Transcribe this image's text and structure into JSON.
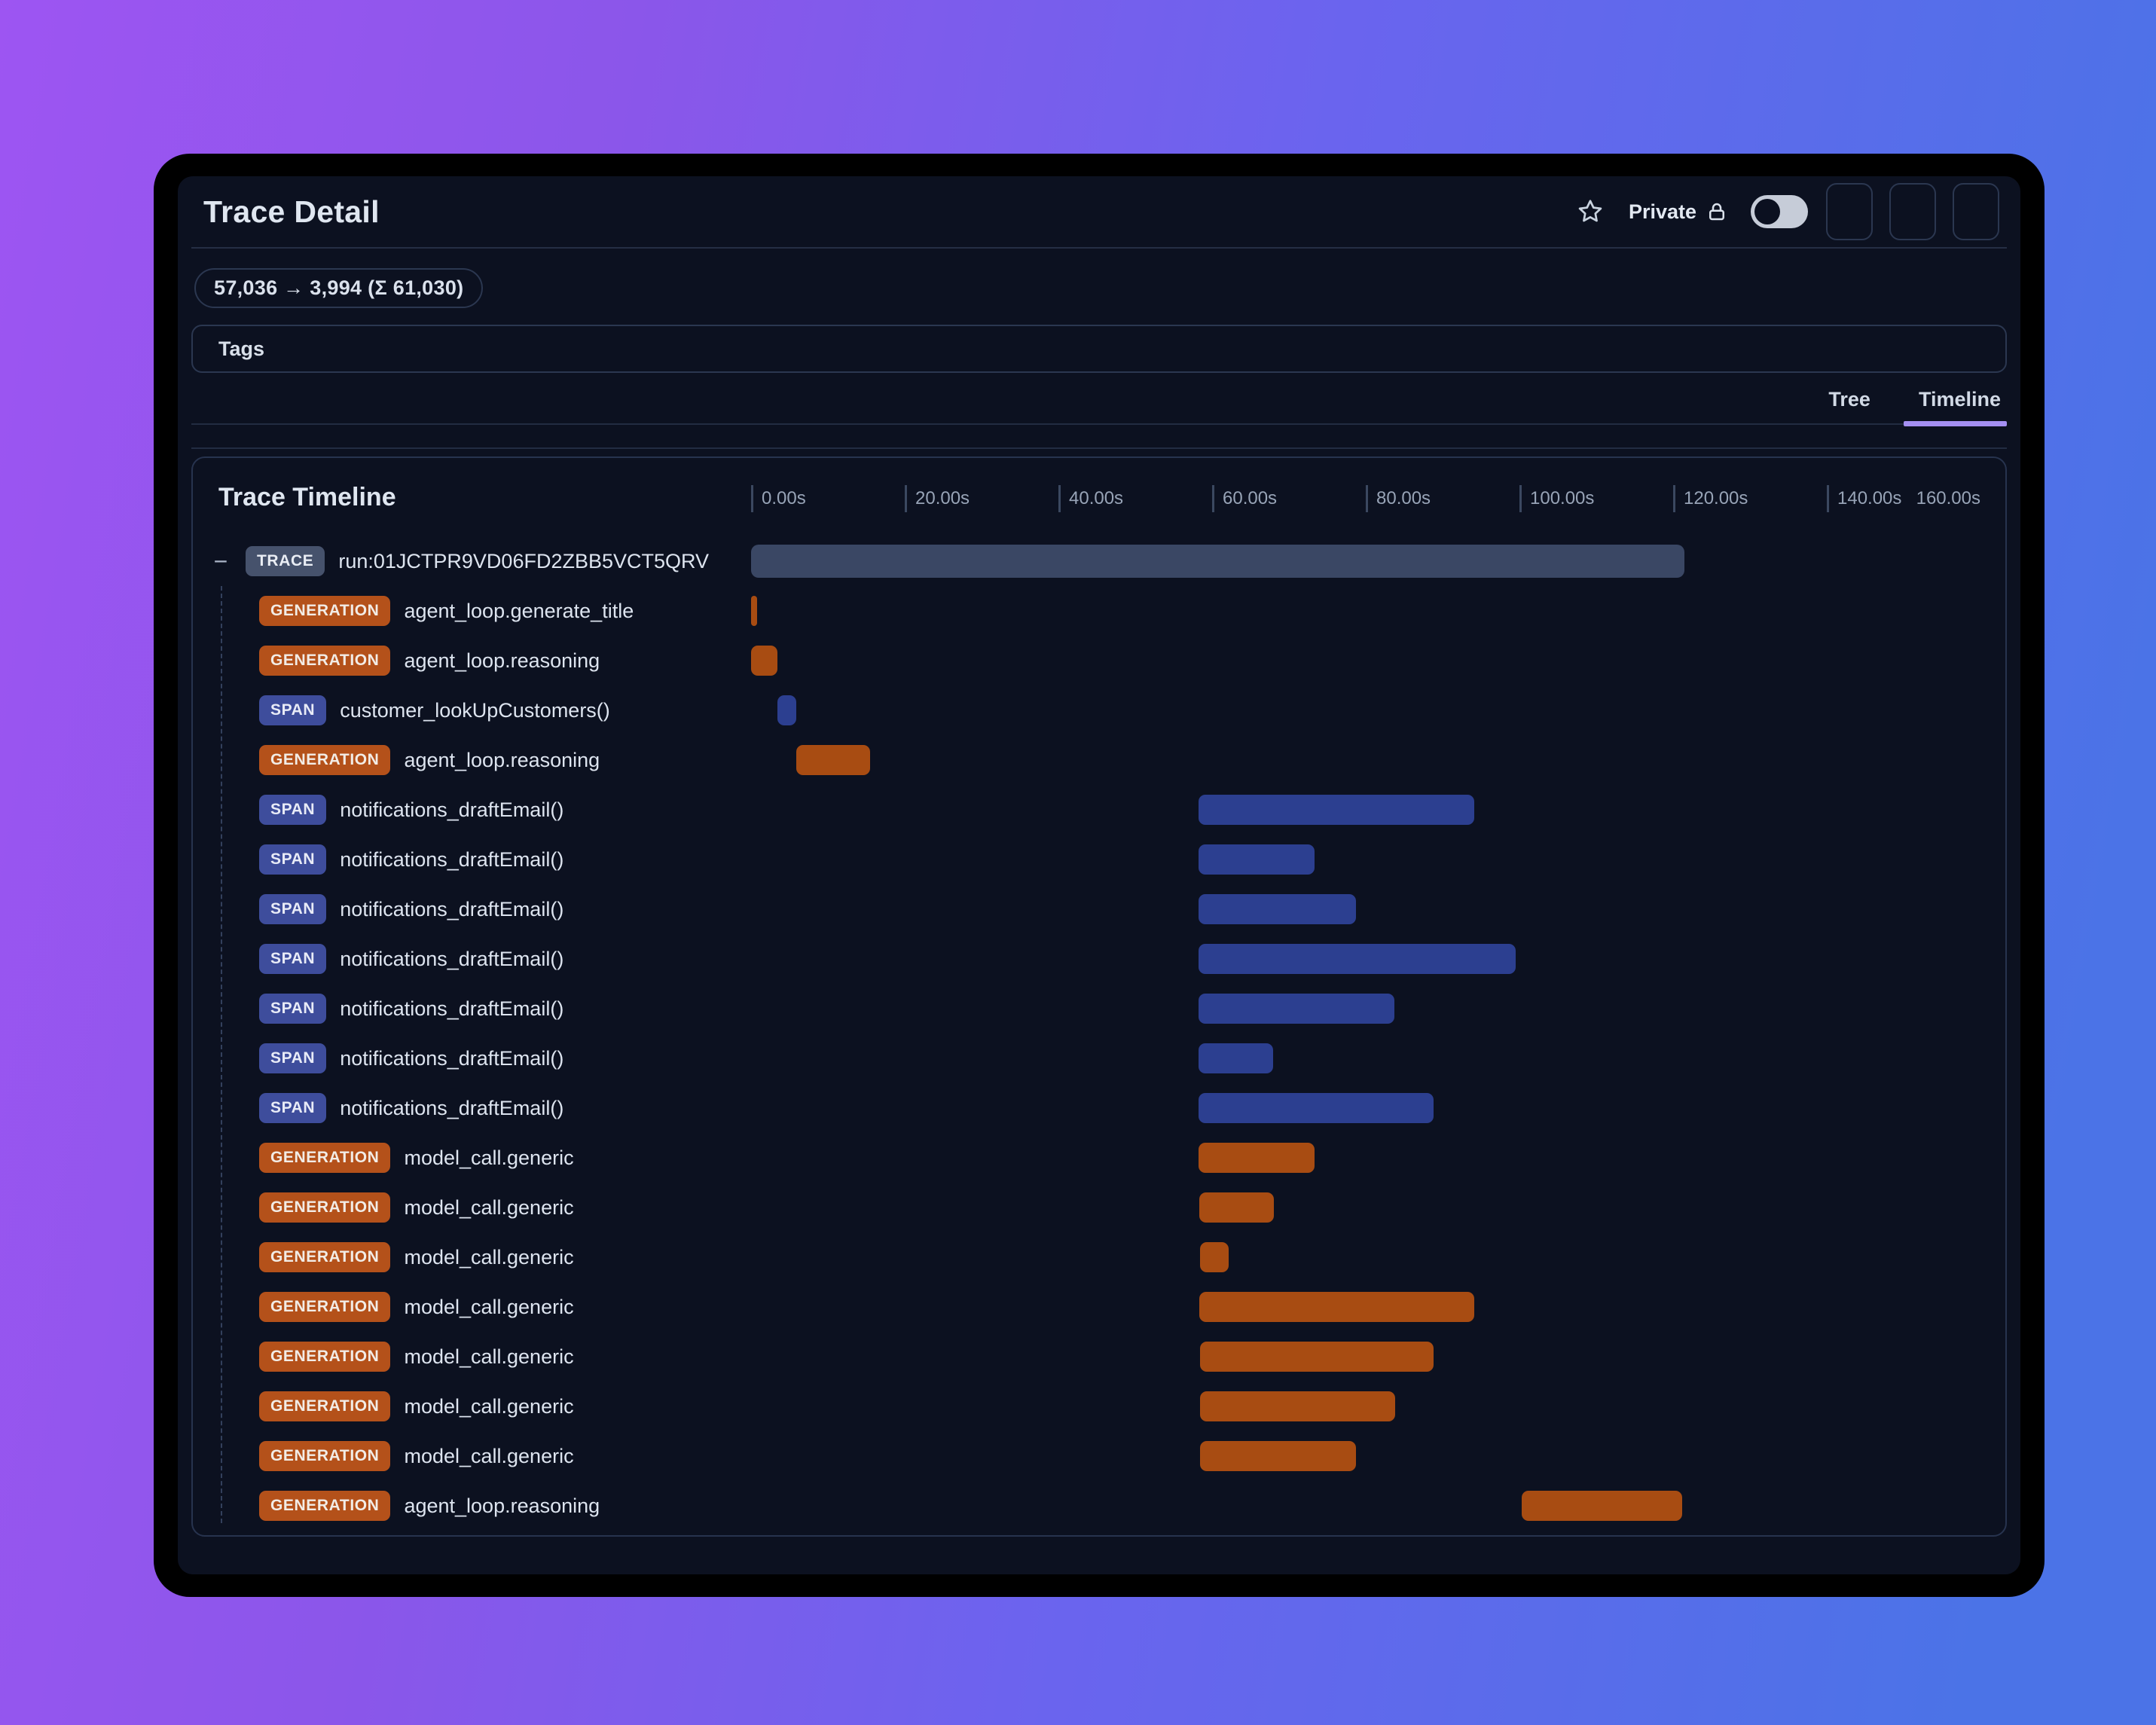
{
  "header": {
    "title": "Trace Detail",
    "favorite_icon": "star-icon",
    "privacy_label": "Private",
    "privacy_icon": "lock-icon",
    "privacy_toggle": {
      "state": "off"
    },
    "buttons": [
      {
        "name": "collapse-up-button",
        "icon": "chevron-up-icon"
      },
      {
        "name": "collapse-down-button",
        "icon": "chevron-down-icon"
      },
      {
        "name": "delete-button",
        "icon": "trash-icon"
      }
    ]
  },
  "token_badge": "57,036 → 3,994 (Σ 61,030)",
  "tags": {
    "label": "Tags"
  },
  "view_tabs": [
    {
      "label": "Tree",
      "icon": "tree-icon",
      "active": false
    },
    {
      "label": "Timeline",
      "icon": "timeline-icon",
      "active": true
    }
  ],
  "timeline": {
    "title": "Trace Timeline",
    "controls": [
      {
        "name": "expand-all-button",
        "icon": "plus-square-icon"
      },
      {
        "name": "collapse-all-button",
        "icon": "minus-square-icon"
      }
    ],
    "collapse_glyph": "−",
    "axis": {
      "max_s": 160,
      "ticks": [
        {
          "s": 0,
          "label": "0.00s"
        },
        {
          "s": 20,
          "label": "20.00s"
        },
        {
          "s": 40,
          "label": "40.00s"
        },
        {
          "s": 60,
          "label": "60.00s"
        },
        {
          "s": 80,
          "label": "80.00s"
        },
        {
          "s": 100,
          "label": "100.00s"
        },
        {
          "s": 120,
          "label": "120.00s"
        },
        {
          "s": 140,
          "label": "140.00s"
        }
      ],
      "end_label": "160.00s"
    },
    "rows": [
      {
        "badge": "TRACE",
        "kind": "trace",
        "name": "run:01JCTPR9VD06FD2ZBB5VCT5QRV",
        "depth": 0,
        "start_s": 0,
        "end_s": 121.5
      },
      {
        "badge": "GENERATION",
        "kind": "generation",
        "name": "agent_loop.generate_title",
        "depth": 1,
        "start_s": 0,
        "end_s": 0.8
      },
      {
        "badge": "GENERATION",
        "kind": "generation",
        "name": "agent_loop.reasoning",
        "depth": 1,
        "start_s": 0,
        "end_s": 3.4
      },
      {
        "badge": "SPAN",
        "kind": "span",
        "name": "customer_lookUpCustomers()",
        "depth": 1,
        "start_s": 3.4,
        "end_s": 5.9
      },
      {
        "badge": "GENERATION",
        "kind": "generation",
        "name": "agent_loop.reasoning",
        "depth": 1,
        "start_s": 5.9,
        "end_s": 15.5
      },
      {
        "badge": "SPAN",
        "kind": "span",
        "name": "notifications_draftEmail()",
        "depth": 1,
        "start_s": 58.2,
        "end_s": 94.1
      },
      {
        "badge": "SPAN",
        "kind": "span",
        "name": "notifications_draftEmail()",
        "depth": 1,
        "start_s": 58.2,
        "end_s": 73.3
      },
      {
        "badge": "SPAN",
        "kind": "span",
        "name": "notifications_draftEmail()",
        "depth": 1,
        "start_s": 58.2,
        "end_s": 78.7
      },
      {
        "badge": "SPAN",
        "kind": "span",
        "name": "notifications_draftEmail()",
        "depth": 1,
        "start_s": 58.2,
        "end_s": 99.5
      },
      {
        "badge": "SPAN",
        "kind": "span",
        "name": "notifications_draftEmail()",
        "depth": 1,
        "start_s": 58.2,
        "end_s": 83.7
      },
      {
        "badge": "SPAN",
        "kind": "span",
        "name": "notifications_draftEmail()",
        "depth": 1,
        "start_s": 58.2,
        "end_s": 67.9
      },
      {
        "badge": "SPAN",
        "kind": "span",
        "name": "notifications_draftEmail()",
        "depth": 1,
        "start_s": 58.2,
        "end_s": 88.8
      },
      {
        "badge": "GENERATION",
        "kind": "generation",
        "name": "model_call.generic",
        "depth": 1,
        "start_s": 58.2,
        "end_s": 73.3
      },
      {
        "badge": "GENERATION",
        "kind": "generation",
        "name": "model_call.generic",
        "depth": 1,
        "start_s": 58.3,
        "end_s": 68.0
      },
      {
        "badge": "GENERATION",
        "kind": "generation",
        "name": "model_call.generic",
        "depth": 1,
        "start_s": 58.4,
        "end_s": 62.2
      },
      {
        "badge": "GENERATION",
        "kind": "generation",
        "name": "model_call.generic",
        "depth": 1,
        "start_s": 58.3,
        "end_s": 94.1
      },
      {
        "badge": "GENERATION",
        "kind": "generation",
        "name": "model_call.generic",
        "depth": 1,
        "start_s": 58.4,
        "end_s": 88.8
      },
      {
        "badge": "GENERATION",
        "kind": "generation",
        "name": "model_call.generic",
        "depth": 1,
        "start_s": 58.4,
        "end_s": 83.8
      },
      {
        "badge": "GENERATION",
        "kind": "generation",
        "name": "model_call.generic",
        "depth": 1,
        "start_s": 58.4,
        "end_s": 78.7
      },
      {
        "badge": "GENERATION",
        "kind": "generation",
        "name": "agent_loop.reasoning",
        "depth": 1,
        "start_s": 100.3,
        "end_s": 121.2
      }
    ]
  },
  "colors": {
    "background_gradient_start": "#9d55f2",
    "background_gradient_end": "#4b73e7",
    "panel_bg": "#0c1120",
    "badge_trace": "#46526c",
    "badge_generation": "#b4511a",
    "badge_span": "#3e4d9c",
    "bar_trace": "#3a4764",
    "bar_generation": "#a84c12",
    "bar_span": "#2c3f90",
    "active_tab_underline": "#a48ff2"
  }
}
